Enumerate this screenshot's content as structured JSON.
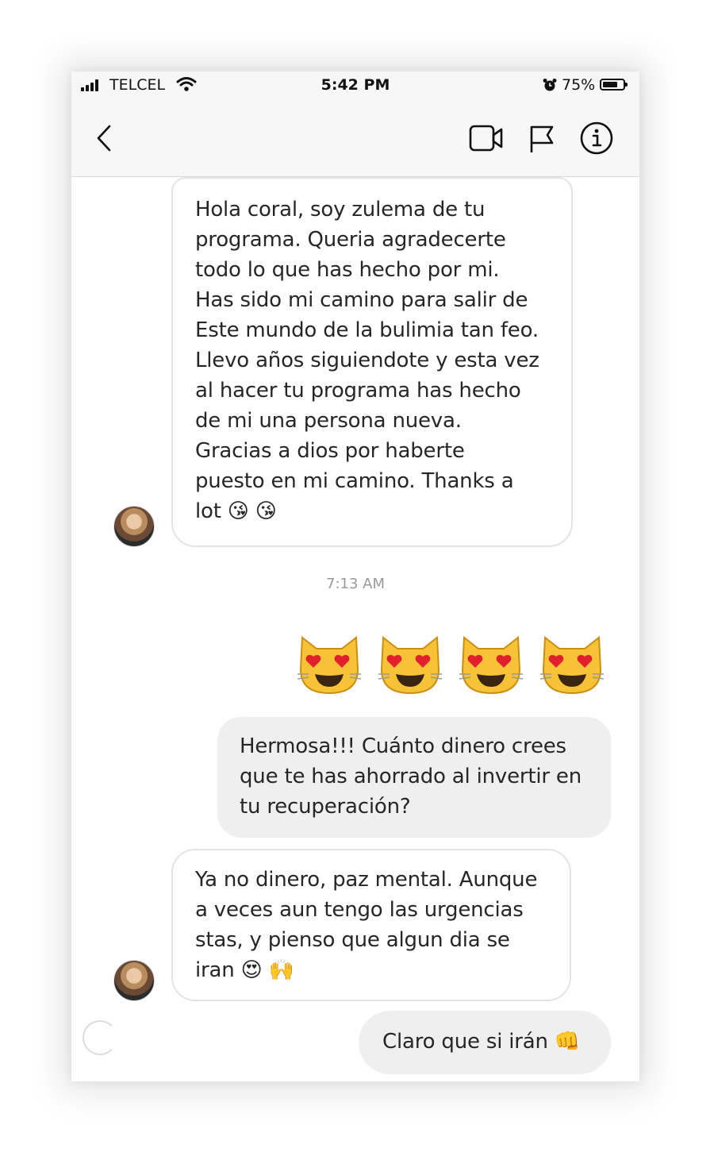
{
  "status_bar": {
    "carrier": "TELCEL",
    "time": "5:42 PM",
    "battery_percent_label": "75%",
    "battery_level": 0.75
  },
  "nav": {
    "icons": [
      "back-chevron-icon",
      "video-call-icon",
      "flag-icon",
      "info-icon"
    ]
  },
  "messages": {
    "m1": {
      "sender": "other",
      "text": "Hola coral, soy zulema de tu\nprograma. Queria agradecerte\ntodo lo que has hecho por mi.\nHas sido mi camino para salir de\nEste mundo de la bulimia tan feo.\nLlevo años siguiendote y esta vez\nal hacer tu programa has hecho\nde mi una persona nueva.\nGracias a dios por haberte\npuesto en mi camino. Thanks a\nlot 😘 😘"
    },
    "timestamp": "7:13 AM",
    "m2": {
      "sender": "me",
      "emoji": [
        "heart-eyes-cat",
        "heart-eyes-cat",
        "heart-eyes-cat",
        "heart-eyes-cat"
      ]
    },
    "m3": {
      "sender": "me",
      "text": "Hermosa!!! Cuánto dinero crees\nque te has ahorrado al invertir en\ntu recuperación?"
    },
    "m4": {
      "sender": "other",
      "text": "Ya no dinero, paz mental. Aunque\na veces aun tengo las urgencias\nstas, y pienso que algun dia se\niran 😍 🙌"
    },
    "m5": {
      "sender": "me",
      "text": "Claro que si irán 👊"
    }
  },
  "colors": {
    "bar_bg": "#f7f7f7",
    "outgoing_bubble": "#efefef",
    "incoming_border": "#e4e4e4",
    "text": "#262626",
    "timestamp": "#999999"
  }
}
